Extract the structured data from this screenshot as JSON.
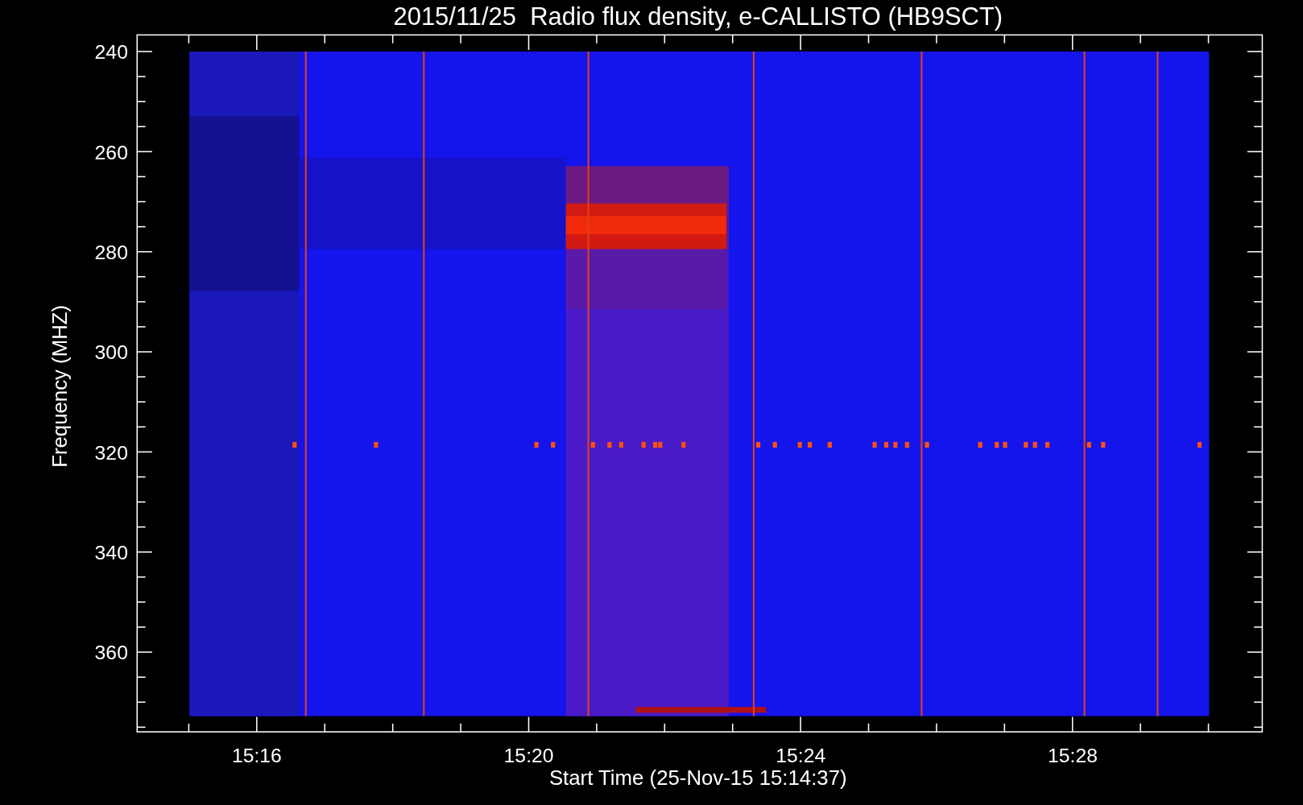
{
  "title": "2015/11/25  Radio flux density, e-CALLISTO (HB9SCT)",
  "y_axis": {
    "label": "Frequency (MHZ)",
    "ticks": [
      "240",
      "260",
      "280",
      "300",
      "320",
      "340",
      "360"
    ]
  },
  "x_axis": {
    "label": "Start Time (25-Nov-15 15:14:37)",
    "ticks": [
      "15:16",
      "15:20",
      "15:24",
      "15:28"
    ]
  }
}
